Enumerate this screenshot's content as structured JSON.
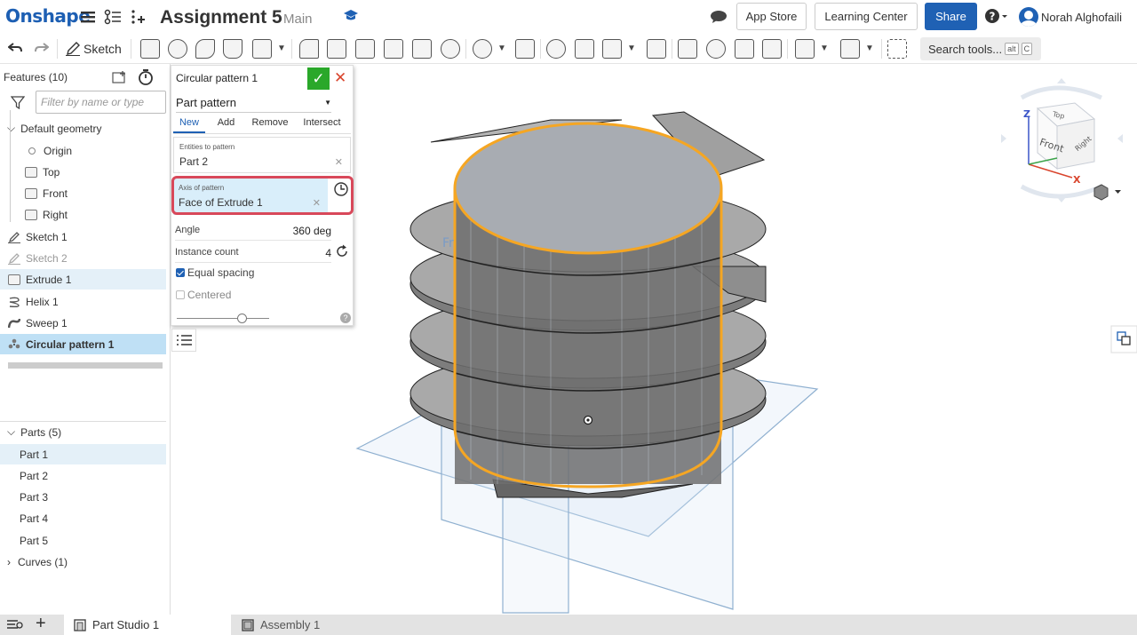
{
  "app": {
    "logo": "Onshape"
  },
  "document": {
    "title": "Assignment 5",
    "branch": "Main"
  },
  "header": {
    "app_store": "App Store",
    "learning_center": "Learning Center",
    "share": "Share",
    "help": "?",
    "user": "Norah Alghofaili"
  },
  "toolbar": {
    "sketch_label": "Sketch",
    "search_placeholder": "Search tools...",
    "search_shortcut_1": "alt",
    "search_shortcut_2": "C"
  },
  "features": {
    "heading": "Features (10)",
    "filter_placeholder": "Filter by name or type",
    "default_geometry": "Default geometry",
    "items": [
      {
        "label": "Origin"
      },
      {
        "label": "Top"
      },
      {
        "label": "Front"
      },
      {
        "label": "Right"
      },
      {
        "label": "Sketch 1"
      },
      {
        "label": "Sketch 2"
      },
      {
        "label": "Extrude 1"
      },
      {
        "label": "Helix 1"
      },
      {
        "label": "Sweep 1"
      },
      {
        "label": "Circular pattern 1"
      }
    ]
  },
  "parts": {
    "heading": "Parts (5)",
    "items": [
      "Part 1",
      "Part 2",
      "Part 3",
      "Part 4",
      "Part 5"
    ],
    "curves": "Curves (1)"
  },
  "dialog": {
    "title": "Circular pattern 1",
    "pattern_type": "Part pattern",
    "tabs": [
      "New",
      "Add",
      "Remove",
      "Intersect"
    ],
    "entities_label": "Entities to pattern",
    "entities_value": "Part 2",
    "axis_label": "Axis of pattern",
    "axis_value": "Face of Extrude 1",
    "angle_label": "Angle",
    "angle_value": "360 deg",
    "count_label": "Instance count",
    "count_value": "4",
    "equal_spacing": "Equal spacing",
    "equal_spacing_checked": true,
    "centered": "Centered",
    "centered_checked": false
  },
  "viewcube": {
    "top": "Top",
    "front": "Front",
    "right": "Right",
    "x": "X",
    "z": "Z"
  },
  "viewport": {
    "plane_label": "Fr"
  },
  "bottom_tabs": [
    {
      "label": "Part Studio 1",
      "active": true
    },
    {
      "label": "Assembly 1",
      "active": false
    }
  ],
  "colors": {
    "accent": "#1f61b4",
    "ok": "#2aa82a",
    "selection_highlight": "#f5a623",
    "highlight_frame": "#d8485a"
  }
}
